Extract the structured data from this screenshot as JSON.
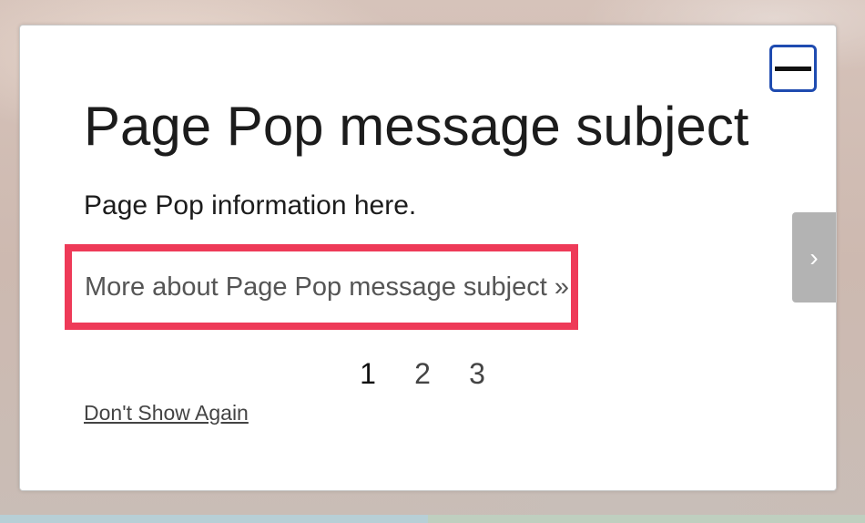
{
  "popup": {
    "title": "Page Pop message subject",
    "info": "Page Pop information here.",
    "more_link": "More about Page Pop message subject »",
    "pages": [
      "1",
      "2",
      "3"
    ],
    "active_page": "1",
    "dont_show_label": "Don't Show Again",
    "next_glyph": "›"
  },
  "icons": {
    "close": "close-icon",
    "next": "chevron-right-icon"
  },
  "colors": {
    "highlight": "#ee3a58",
    "close_border": "#1f4bb0",
    "next_bg": "#b3b3b3"
  }
}
